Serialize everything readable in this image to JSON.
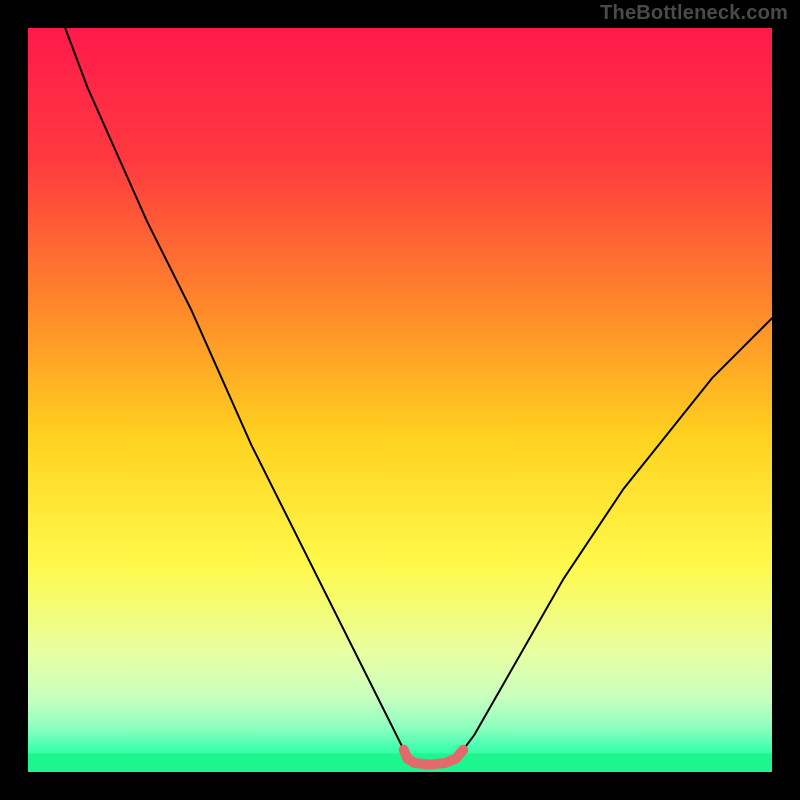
{
  "watermark": "TheBottleneck.com",
  "chart_data": {
    "type": "line",
    "title": "",
    "xlabel": "",
    "ylabel": "",
    "xlim": [
      0,
      100
    ],
    "ylim": [
      0,
      100
    ],
    "gradient_stops": [
      {
        "offset": 0.0,
        "color": "#ff1a4b"
      },
      {
        "offset": 0.18,
        "color": "#ff3a3f"
      },
      {
        "offset": 0.38,
        "color": "#ff8a2a"
      },
      {
        "offset": 0.55,
        "color": "#ffd21f"
      },
      {
        "offset": 0.72,
        "color": "#fff94a"
      },
      {
        "offset": 0.84,
        "color": "#e8ffa2"
      },
      {
        "offset": 0.9,
        "color": "#c8ffbf"
      },
      {
        "offset": 0.94,
        "color": "#8dffc0"
      },
      {
        "offset": 0.97,
        "color": "#3dffac"
      },
      {
        "offset": 1.0,
        "color": "#17f58d"
      }
    ],
    "series": [
      {
        "name": "left-curve",
        "color": "#000000",
        "width": 2,
        "x": [
          5.0,
          8.0,
          12.0,
          16.0,
          18.0,
          22.0,
          26.0,
          30.0,
          34.0,
          38.0,
          42.0,
          46.0,
          49.0,
          50.5
        ],
        "y": [
          100.0,
          92.0,
          83.0,
          74.0,
          70.0,
          62.0,
          53.0,
          44.0,
          36.0,
          28.0,
          20.0,
          12.0,
          6.0,
          3.0
        ]
      },
      {
        "name": "right-curve",
        "color": "#000000",
        "width": 2,
        "x": [
          58.5,
          60.0,
          64.0,
          68.0,
          72.0,
          76.0,
          80.0,
          84.0,
          88.0,
          92.0,
          96.0,
          100.0
        ],
        "y": [
          3.0,
          5.0,
          12.0,
          19.0,
          26.0,
          32.0,
          38.0,
          43.0,
          48.0,
          53.0,
          57.0,
          61.0
        ]
      },
      {
        "name": "bottom-bridge",
        "color": "#e26a6a",
        "width": 10,
        "x": [
          50.5,
          51.0,
          52.0,
          54.0,
          56.0,
          57.5,
          58.5
        ],
        "y": [
          3.0,
          1.8,
          1.2,
          1.0,
          1.2,
          1.8,
          3.0
        ]
      }
    ],
    "green_band": {
      "y_start": 0.0,
      "y_end": 2.5,
      "color": "#1df58f"
    }
  }
}
